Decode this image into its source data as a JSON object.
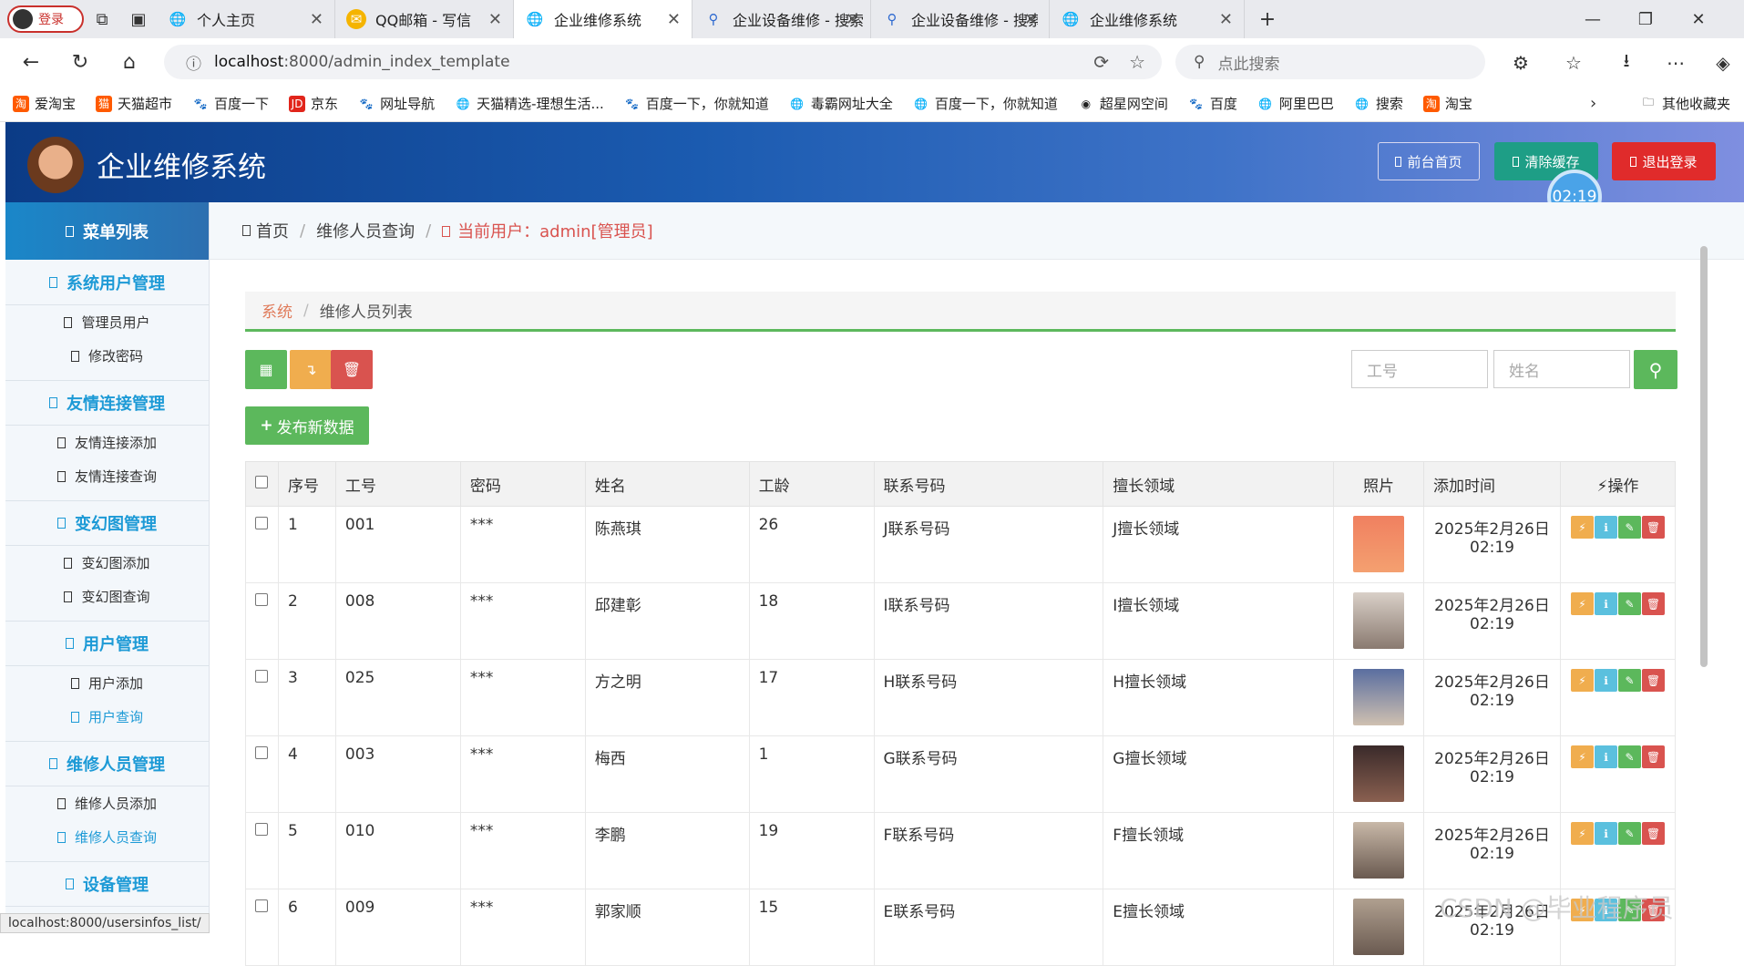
{
  "browser": {
    "login_label": "登录",
    "tabs": [
      {
        "title": "个人主页",
        "icon": "globe-icon"
      },
      {
        "title": "QQ邮箱 - 写信",
        "icon": "qqmail-icon"
      },
      {
        "title": "企业维修系统",
        "icon": "globe-icon",
        "active": true
      },
      {
        "title": "企业设备维修 - 搜索",
        "icon": "search-icon"
      },
      {
        "title": "企业设备维修 - 搜索 图片",
        "icon": "search-icon"
      },
      {
        "title": "企业维修系统",
        "icon": "globe-icon"
      }
    ],
    "url_host": "localhost",
    "url_path": ":8000/admin_index_template",
    "search_placeholder": "点此搜索",
    "bookmarks": [
      "爱淘宝",
      "天猫超市",
      "百度一下",
      "京东",
      "网址导航",
      "天猫精选-理想生活...",
      "百度一下，你就知道",
      "毒霸网址大全",
      "百度一下，你就知道",
      "超星网空间",
      "百度",
      "阿里巴巴",
      "搜索",
      "淘宝"
    ],
    "other_bookmarks": "其他收藏夹",
    "status_url": "localhost:8000/usersinfos_list/"
  },
  "header": {
    "title": "企业维修系统",
    "btn_front": "前台首页",
    "btn_clear": "清除缓存",
    "btn_logout": "退出登录",
    "timer": "02:19",
    "colors": {
      "front": "transparent",
      "clear": "#1e9e86",
      "logout": "#e02b2b"
    }
  },
  "sidebar": {
    "title": "菜单列表",
    "groups": [
      {
        "label": "系统用户管理",
        "items": [
          "管理员用户",
          "修改密码"
        ]
      },
      {
        "label": "友情连接管理",
        "items": [
          "友情连接添加",
          "友情连接查询"
        ]
      },
      {
        "label": "变幻图管理",
        "items": [
          "变幻图添加",
          "变幻图查询"
        ]
      },
      {
        "label": "用户管理",
        "items": [
          "用户添加",
          "用户查询"
        ]
      },
      {
        "label": "维修人员管理",
        "items": [
          "维修人员添加",
          "维修人员查询"
        ]
      },
      {
        "label": "设备管理",
        "items": []
      }
    ]
  },
  "breadcrumb": {
    "home": "首页",
    "page": "维修人员查询",
    "user": "当前用户：admin[管理员]"
  },
  "panel": {
    "sys": "系统",
    "title": "维修人员列表"
  },
  "filters": {
    "job_no_placeholder": "工号",
    "name_placeholder": "姓名"
  },
  "add_button": "发布新数据",
  "table": {
    "headers": [
      "序号",
      "工号",
      "密码",
      "姓名",
      "工龄",
      "联系号码",
      "擅长领域",
      "照片",
      "添加时间",
      "操作"
    ],
    "rows": [
      {
        "no": "1",
        "job": "001",
        "pwd": "***",
        "name": "陈燕琪",
        "years": "26",
        "phone": "J联系号码",
        "field": "J擅长领域",
        "time1": "2025年2月26日",
        "time2": "02:19"
      },
      {
        "no": "2",
        "job": "008",
        "pwd": "***",
        "name": "邱建彰",
        "years": "18",
        "phone": "I联系号码",
        "field": "I擅长领域",
        "time1": "2025年2月26日",
        "time2": "02:19"
      },
      {
        "no": "3",
        "job": "025",
        "pwd": "***",
        "name": "方之明",
        "years": "17",
        "phone": "H联系号码",
        "field": "H擅长领域",
        "time1": "2025年2月26日",
        "time2": "02:19"
      },
      {
        "no": "4",
        "job": "003",
        "pwd": "***",
        "name": "梅西",
        "years": "1",
        "phone": "G联系号码",
        "field": "G擅长领域",
        "time1": "2025年2月26日",
        "time2": "02:19"
      },
      {
        "no": "5",
        "job": "010",
        "pwd": "***",
        "name": "李鹏",
        "years": "19",
        "phone": "F联系号码",
        "field": "F擅长领域",
        "time1": "2025年2月26日",
        "time2": "02:19"
      },
      {
        "no": "6",
        "job": "009",
        "pwd": "***",
        "name": "郭家顺",
        "years": "15",
        "phone": "E联系号码",
        "field": "E擅长领域",
        "time1": "2025年2月26日",
        "time2": "02:19"
      }
    ]
  },
  "watermark": "CSDN @毕业程序员"
}
